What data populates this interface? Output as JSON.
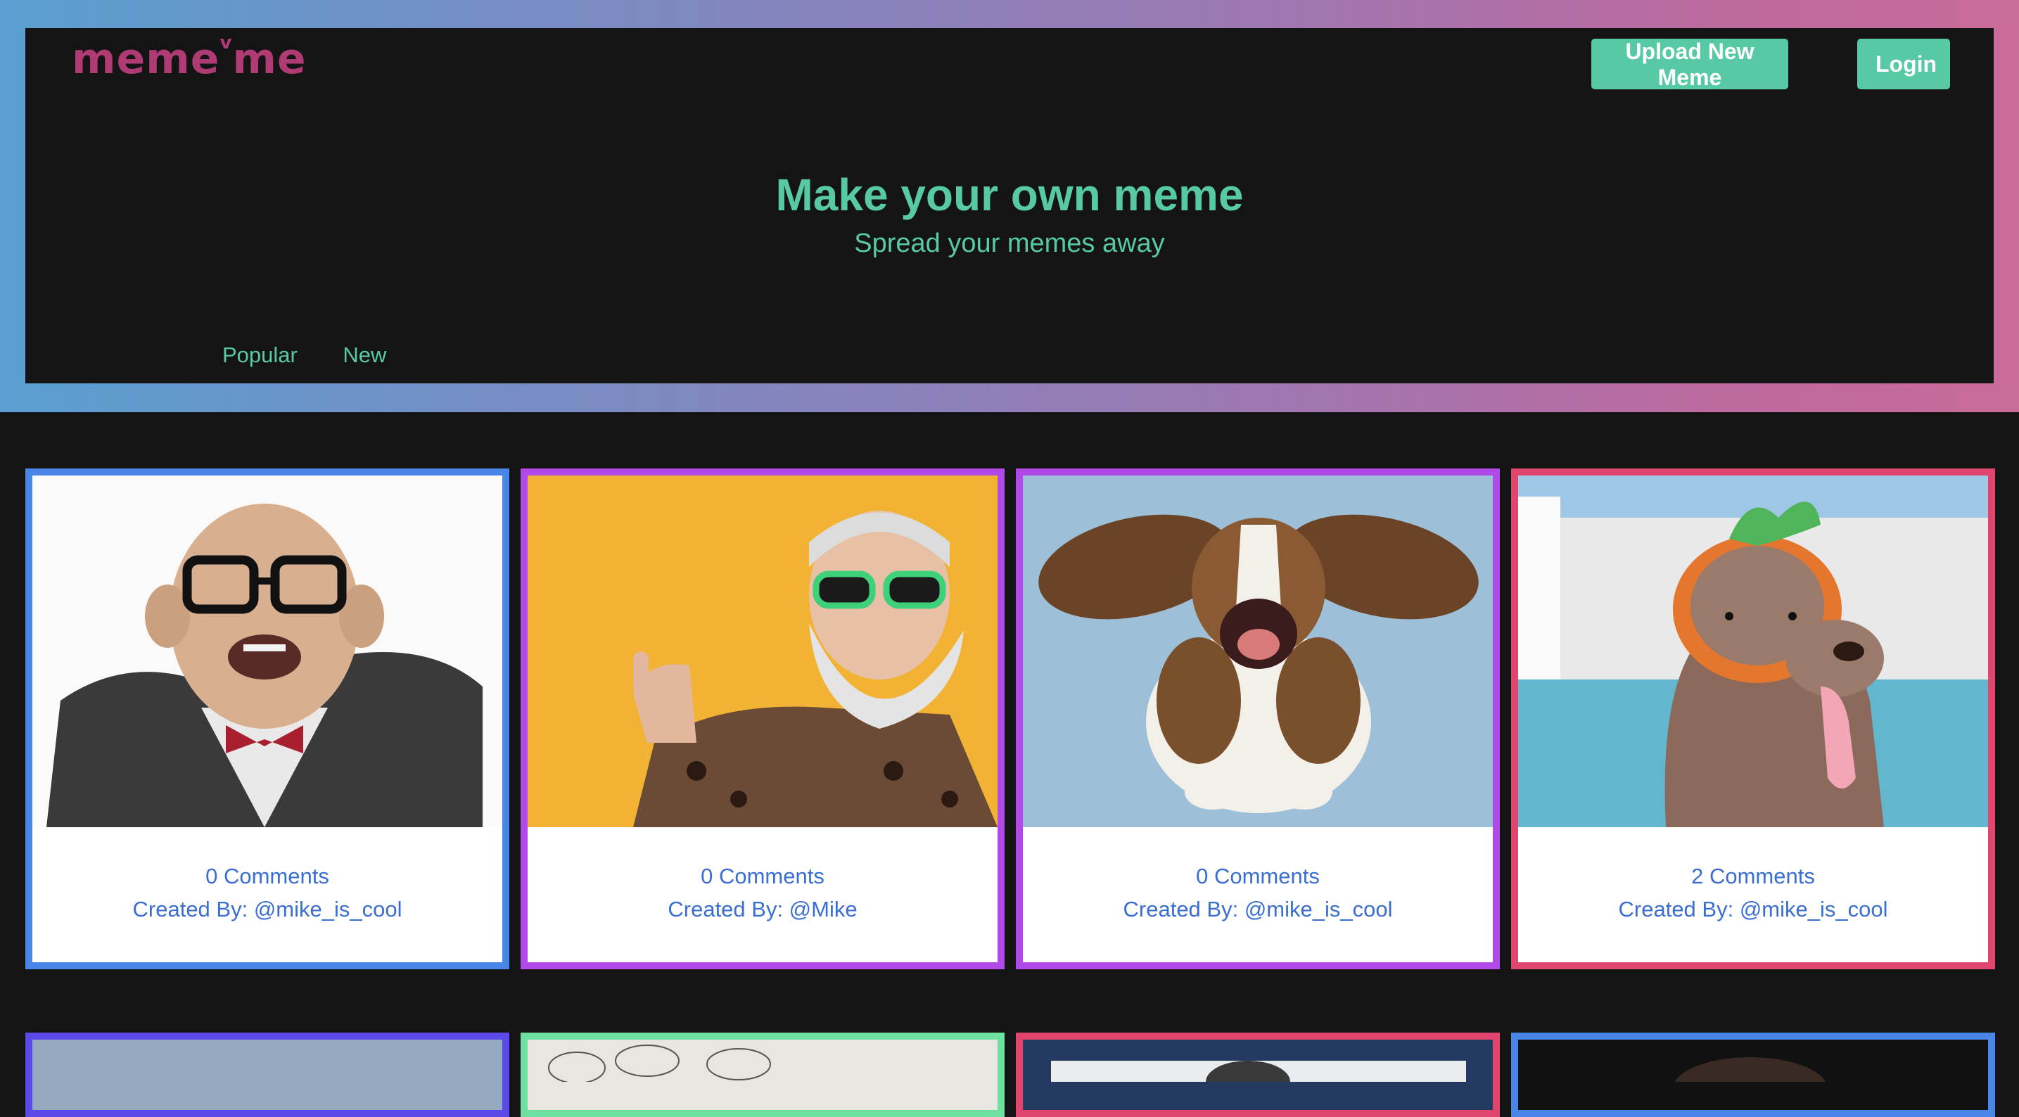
{
  "header": {
    "logo": "meme",
    "logo_super": "v",
    "logo_suffix": "me",
    "upload_button": "Upload New Meme",
    "login_button": "Login",
    "title": "Make your own meme",
    "subtitle": "Spread your memes away",
    "tabs": [
      "Popular",
      "New"
    ]
  },
  "colors": {
    "accent": "#57c9a4",
    "logo": "#b03a74",
    "link": "#3a6fd1",
    "background": "#141414"
  },
  "cards": [
    {
      "comments": "0 Comments",
      "creator": "Created By: @mike_is_cool",
      "border": "#4a86e8",
      "image": "bald-old-man-photo"
    },
    {
      "comments": "0 Comments",
      "creator": "Created By: @Mike",
      "border": "#b14ae8",
      "image": "bearded-man-sunglasses-photo"
    },
    {
      "comments": "0 Comments",
      "creator": "Created By: @mike_is_cool",
      "border": "#b14ae8",
      "image": "basset-hound-photo"
    },
    {
      "comments": "2 Comments",
      "creator": "Created By: @mike_is_cool",
      "border": "#e0456e",
      "image": "dog-pumpkin-hat-photo"
    }
  ],
  "cards_row2": [
    {
      "border": "#5b4ae8"
    },
    {
      "border": "#6ee0a0"
    },
    {
      "border": "#e0456e"
    },
    {
      "border": "#4a86e8"
    }
  ]
}
